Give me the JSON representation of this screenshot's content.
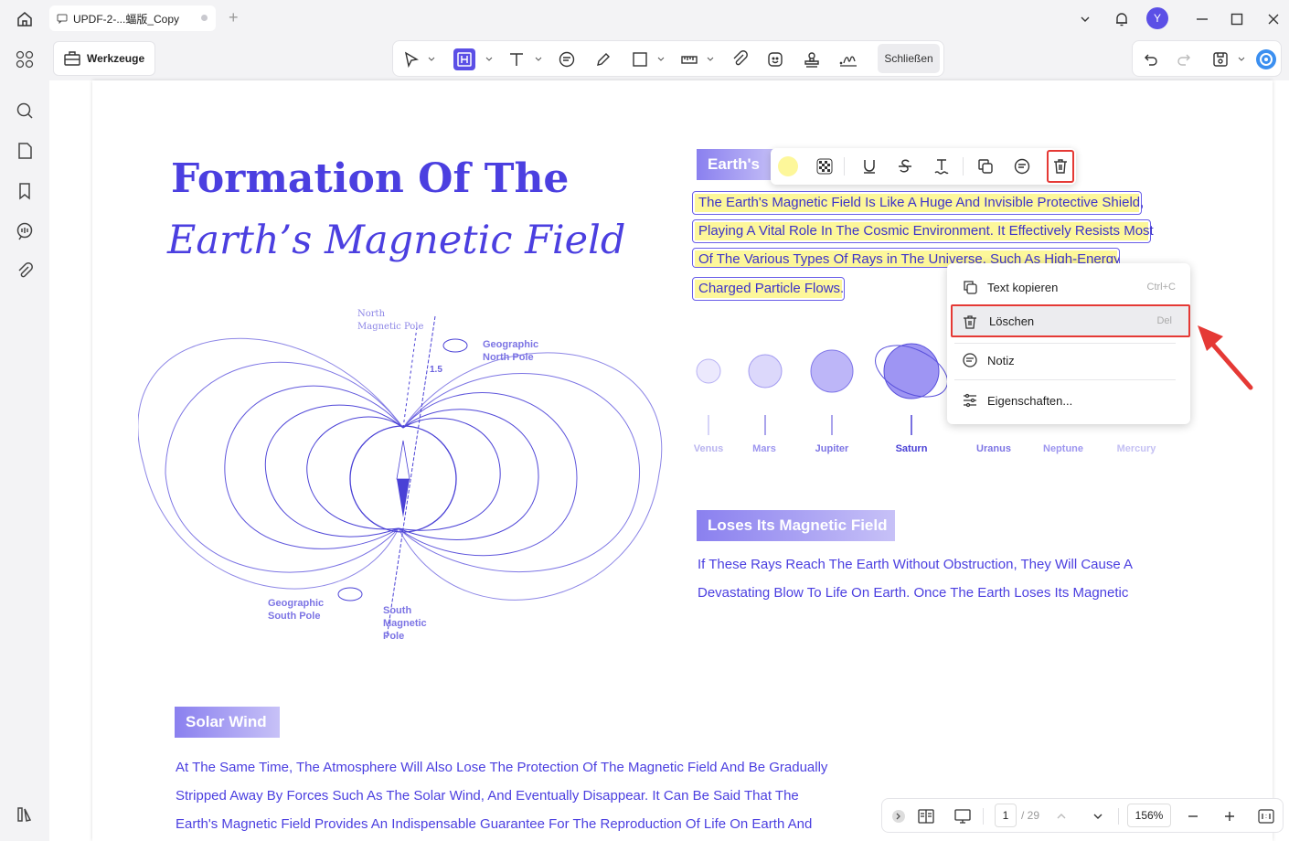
{
  "tab": {
    "title": "UPDF-2-...蝠版_Copy"
  },
  "window": {
    "avatar": "Y"
  },
  "toolbar": {
    "tools_label": "Werkzeuge",
    "close_label": "Schließen"
  },
  "document": {
    "title_line1": "Formation Of The",
    "title_line2": "Earth’s Magnetic Field",
    "diagram": {
      "north_magnetic_pole": "North\nMagnetic Pole",
      "geographic_north_pole": "Geographic\nNorth Pole",
      "tilt": "1.5",
      "geographic_south_pole": "Geographic\nSouth Pole",
      "south_magnetic_pole": "South\nMagnetic\nPole"
    },
    "section1_heading": "Earth's",
    "highlighted_lines": [
      "The Earth's Magnetic Field Is Like A Huge And Invisible Protective Shield,",
      "Playing A Vital Role In The Cosmic Environment. It Effectively Resists Most",
      "Of The Various Types Of Rays in The Universe, Such As High-Energy",
      "Charged Particle Flows."
    ],
    "planets": [
      "Venus",
      "Mars",
      "Jupiter",
      "Saturn",
      "Uranus",
      "Neptune",
      "Mercury"
    ],
    "section2_heading": "Loses Its Magnetic Field",
    "section2_lines": [
      "If These Rays Reach The Earth Without Obstruction, They Will Cause A",
      "Devastating Blow To Life On Earth. Once The Earth Loses Its Magnetic"
    ],
    "section3_heading": "Solar Wind",
    "section3_lines": [
      "At The Same Time, The Atmosphere Will Also Lose The Protection Of The Magnetic Field And Be Gradually",
      "Stripped Away By Forces Such As The Solar Wind, And Eventually Disappear. It Can Be Said That The",
      "Earth's Magnetic Field Provides An Indispensable Guarantee For The Reproduction Of Life On Earth And"
    ]
  },
  "context_menu": {
    "copy_label": "Text kopieren",
    "copy_shortcut": "Ctrl+C",
    "delete_label": "Löschen",
    "delete_shortcut": "Del",
    "note_label": "Notiz",
    "properties_label": "Eigenschaften..."
  },
  "status": {
    "page_current": "1",
    "page_total": "/ 29",
    "zoom": "156%"
  },
  "colors": {
    "accent": "#5b4fe6",
    "highlight": "#fdf79a",
    "callout": "#e53935",
    "text": "#4b3fe0"
  }
}
